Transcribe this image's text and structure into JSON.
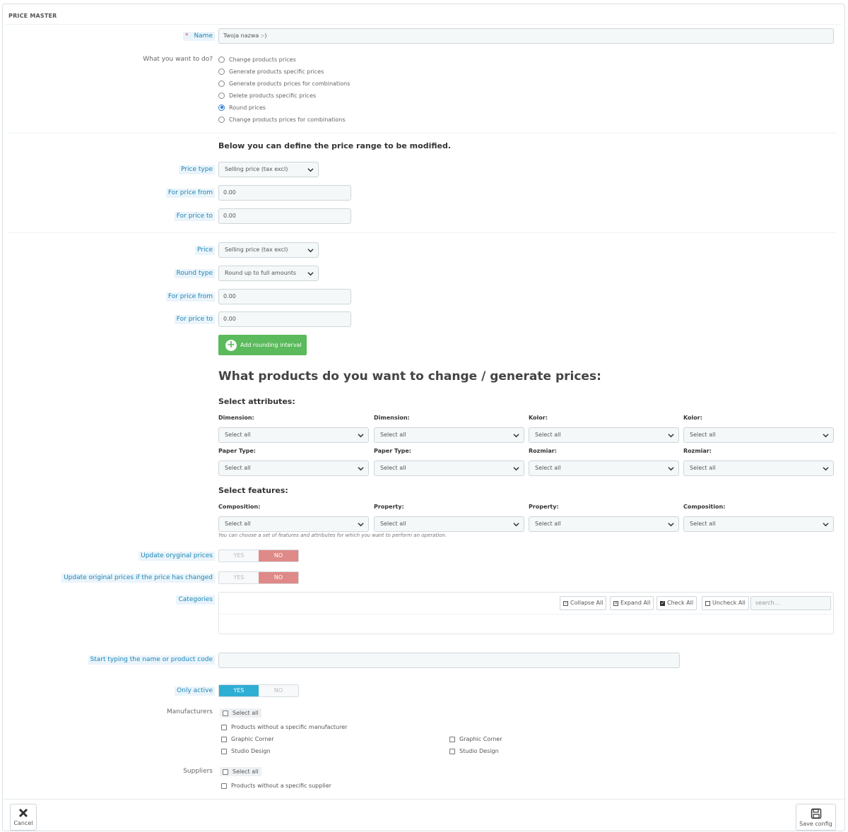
{
  "panel": {
    "title": "PRICE MASTER"
  },
  "form": {
    "name_label": "Name",
    "name_required": "*",
    "name_value": "Twoja nazwa :-)",
    "action_label": "What you want to do?",
    "actions": [
      {
        "label": "Change products prices",
        "selected": false
      },
      {
        "label": "Generate products specific prices",
        "selected": false
      },
      {
        "label": "Generate products prices for combinations",
        "selected": false
      },
      {
        "label": "Delete products specific prices",
        "selected": false
      },
      {
        "label": "Round prices",
        "selected": true
      },
      {
        "label": "Change products prices for combinations",
        "selected": false
      }
    ]
  },
  "range": {
    "heading": "Below you can define the price range to be modified.",
    "price_type_label": "Price type",
    "price_type_value": "Selling price (tax excl)",
    "from_label": "For price from",
    "from_value": "0.00",
    "to_label": "For price to",
    "to_value": "0.00"
  },
  "rounding": {
    "price_label": "Price",
    "price_value": "Selling price (tax excl)",
    "round_type_label": "Round type",
    "round_type_value": "Round up to full amounts",
    "from_label": "For price from",
    "from_value": "0.00",
    "to_label": "For price to",
    "to_value": "0.00",
    "add_button": "Add rounding interval",
    "add_button_icon": "plus-circle-icon"
  },
  "products": {
    "heading": "What products do you want to change / generate prices:",
    "attributes_heading": "Select attributes:",
    "attributes_row1": [
      {
        "label": "Dimension:",
        "value": "Select all"
      },
      {
        "label": "Dimension:",
        "value": "Select all"
      },
      {
        "label": "Kolor:",
        "value": "Select all"
      },
      {
        "label": "Kolor:",
        "value": "Select all"
      }
    ],
    "attributes_row2": [
      {
        "label": "Paper Type:",
        "value": "Select all"
      },
      {
        "label": "Paper Type:",
        "value": "Select all"
      },
      {
        "label": "Rozmiar:",
        "value": "Select all"
      },
      {
        "label": "Rozmiar:",
        "value": "Select all"
      }
    ],
    "features_heading": "Select features:",
    "features": [
      {
        "label": "Composition:",
        "value": "Select all"
      },
      {
        "label": "Property:",
        "value": "Select all"
      },
      {
        "label": "Property:",
        "value": "Select all"
      },
      {
        "label": "Composition:",
        "value": "Select all"
      }
    ],
    "hint": "You can choose a set of features and attributes for which you want to perform an operation."
  },
  "toggles": {
    "update_label": "Update oryginal prices",
    "update_changed_label": "Update original prices if the price has changed",
    "only_active_label": "Only active",
    "yes": "YES",
    "no": "NO",
    "update_value": "NO",
    "update_changed_value": "NO",
    "only_active_value": "YES"
  },
  "categories": {
    "label": "Categories",
    "collapse": "Collapse All",
    "expand": "Expand All",
    "check": "Check All",
    "uncheck": "Uncheck All",
    "search_placeholder": "search..."
  },
  "product_search": {
    "label": "Start typing the name or product code",
    "value": ""
  },
  "manufacturers": {
    "label": "Manufacturers",
    "select_all": "Select all",
    "without": "Products without a specific manufacturer",
    "col1": [
      "Graphic Corner",
      "Studio Design"
    ],
    "col2": [
      "Graphic Corner",
      "Studio Design"
    ]
  },
  "suppliers": {
    "label": "Suppliers",
    "select_all": "Select all",
    "without": "Products without a specific supplier"
  },
  "footer": {
    "cancel": "Cancel",
    "save": "Save config",
    "cancel_icon": "close-icon",
    "save_icon": "floppy-disk-icon"
  },
  "colors": {
    "label_blue": "#1e86b5",
    "green": "#5bba5b",
    "no_red": "#e08989",
    "yes_blue": "#2faed4",
    "radio_blue": "#2a7bd4"
  }
}
